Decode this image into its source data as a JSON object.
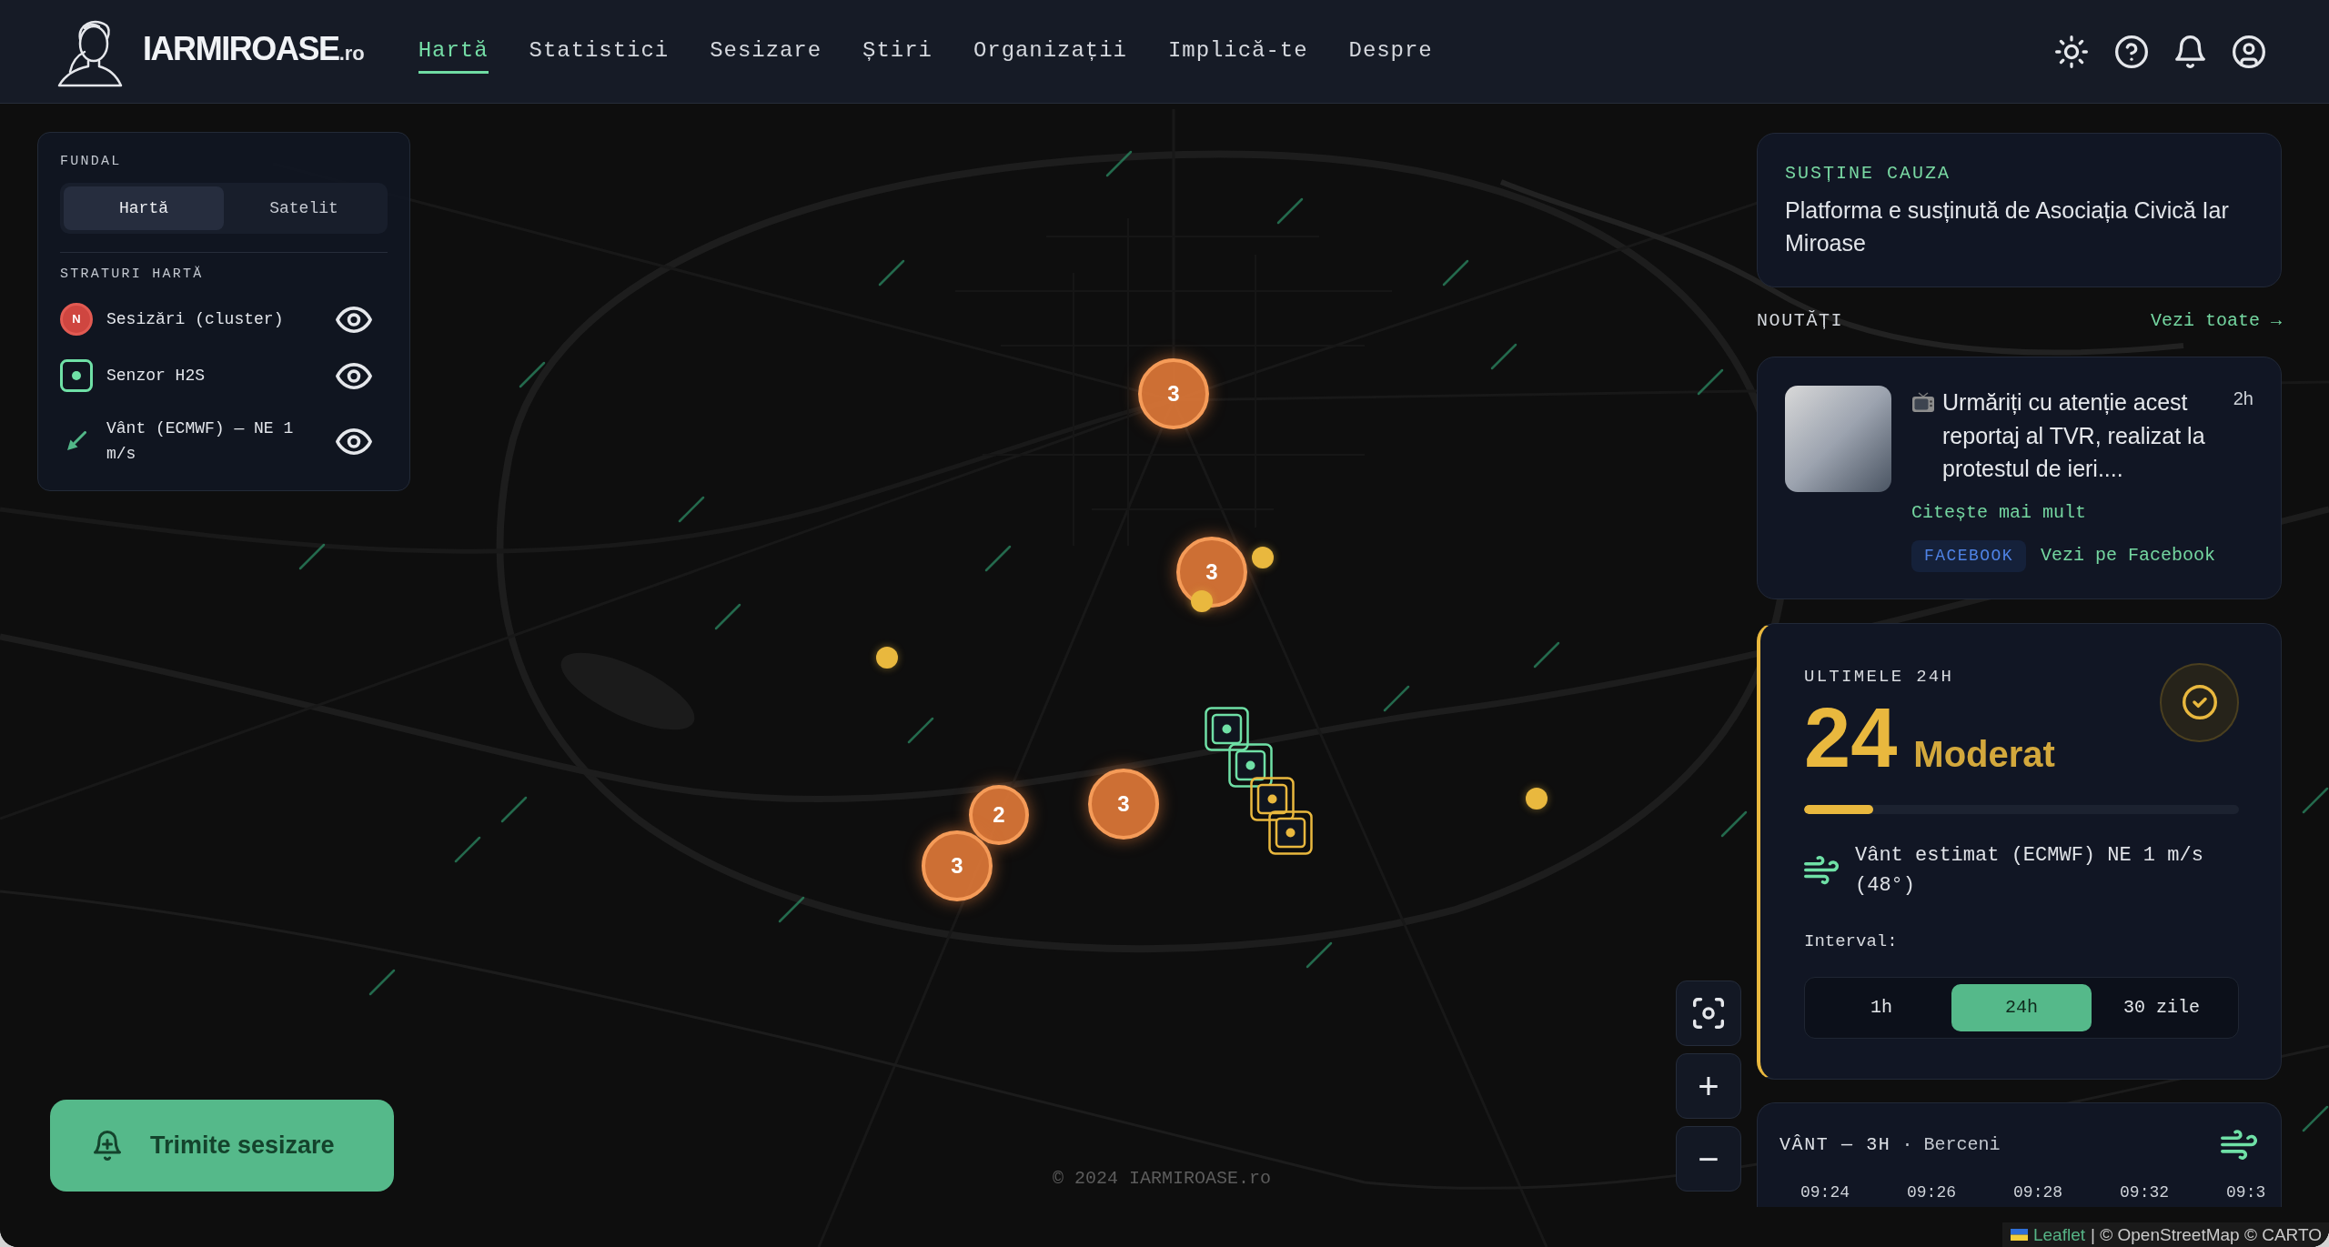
{
  "header": {
    "logo": {
      "name": "IARMIROASE",
      "suffix": ".ro"
    },
    "nav": [
      {
        "label": "Hartă",
        "selected": true
      },
      {
        "label": "Statistici",
        "selected": false
      },
      {
        "label": "Sesizare",
        "selected": false
      },
      {
        "label": "Știri",
        "selected": false
      },
      {
        "label": "Organizații",
        "selected": false
      },
      {
        "label": "Implică-te",
        "selected": false
      },
      {
        "label": "Despre",
        "selected": false
      }
    ]
  },
  "map": {
    "layers_panel": {
      "base_title": "FUNDAL",
      "base_options": [
        {
          "label": "Hartă",
          "selected": true
        },
        {
          "label": "Satelit",
          "selected": false
        }
      ],
      "layers_title": "STRATURI HARTĂ",
      "layers": [
        {
          "kind": "cluster",
          "badge": "N",
          "label": "Sesizări (cluster)",
          "visible": true
        },
        {
          "kind": "sensor",
          "label": "Senzor H2S",
          "visible": true
        },
        {
          "kind": "wind",
          "label": "Vânt (ECMWF) — NE 1 m/s",
          "visible": true
        }
      ]
    },
    "clusters": [
      {
        "count": "3"
      },
      {
        "count": "3"
      },
      {
        "count": "3"
      },
      {
        "count": "2"
      },
      {
        "count": "3"
      }
    ],
    "sensors": [
      {
        "color": "#6fe0a6"
      },
      {
        "color": "#6fe0a6"
      },
      {
        "color": "#e9b83e"
      },
      {
        "color": "#e9b83e"
      }
    ],
    "zoom_controls": [
      "+",
      "−"
    ],
    "report_button": {
      "label": "Trimite sesizare"
    },
    "copyright": "© 2024 IARMIROASE.ro",
    "attribution": {
      "link": "Leaflet",
      "text": "| © OpenStreetMap © CARTO"
    }
  },
  "sidebar": {
    "support": {
      "title": "SUSȚINE CAUZA",
      "text": "Platforma e susținută de Asociația Civică Iar Miroase"
    },
    "news": {
      "title": "NOUTĂȚI",
      "see_all": "Vezi toate →",
      "items": [
        {
          "text": "Urmăriți cu atenție acest reportaj al TVR, realizat la protestul de ieri....",
          "time": "2h",
          "read_more": "Citește mai mult",
          "source": "FACEBOOK",
          "source_link": "Vezi pe Facebook"
        }
      ]
    },
    "air_quality": {
      "title": "ULTIMELE 24H",
      "value": "24",
      "label": "Moderat",
      "level": 0.16,
      "wind": "Vânt estimat (ECMWF) NE 1 m/s (48°)",
      "interval_label": "Interval:",
      "intervals": [
        {
          "label": "1h",
          "selected": false
        },
        {
          "label": "24h",
          "selected": true
        },
        {
          "label": "30 zile",
          "selected": false
        }
      ]
    },
    "wind_forecast": {
      "title": "VÂNT — 3H",
      "location": "· Berceni",
      "times": [
        "09:24",
        "09:26",
        "09:28",
        "09:32",
        "09:3"
      ]
    }
  }
}
